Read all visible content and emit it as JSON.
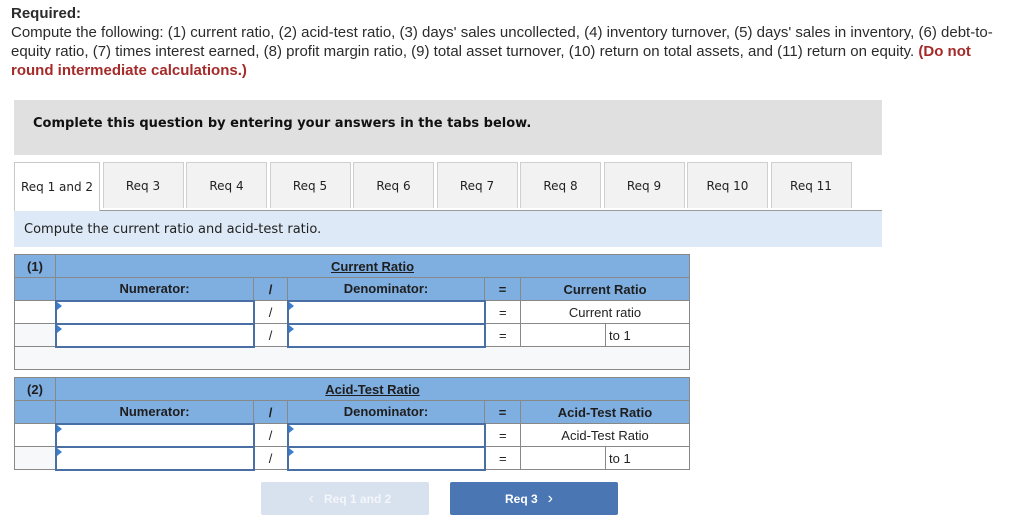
{
  "required": {
    "heading": "Required:",
    "text": "Compute the following: (1) current ratio, (2) acid-test ratio, (3) days' sales uncollected, (4) inventory turnover, (5) days' sales in inventory, (6) debt-to-equity ratio, (7) times interest earned, (8) profit margin ratio, (9) total asset turnover, (10) return on total assets, and (11) return on equity.",
    "warning": "(Do not round intermediate calculations.)"
  },
  "banner": "Complete this question by entering your answers in the tabs below.",
  "tabs": [
    {
      "label": "Req 1 and 2",
      "active": true
    },
    {
      "label": "Req 3"
    },
    {
      "label": "Req 4"
    },
    {
      "label": "Req 5"
    },
    {
      "label": "Req 6"
    },
    {
      "label": "Req 7"
    },
    {
      "label": "Req 8"
    },
    {
      "label": "Req 9"
    },
    {
      "label": "Req 10"
    },
    {
      "label": "Req 11"
    }
  ],
  "instruction": "Compute the current ratio and acid-test ratio.",
  "section1": {
    "number": "(1)",
    "title": "Current Ratio",
    "numerator_header": "Numerator:",
    "div_symbol": "/",
    "denominator_header": "Denominator:",
    "eq_symbol": "=",
    "result_header": "Current Ratio",
    "row1_result_label": "Current ratio",
    "row2_suffix": "to 1",
    "numerator_values": [
      "",
      ""
    ],
    "denominator_values": [
      "",
      ""
    ],
    "ratio_value": ""
  },
  "section2": {
    "number": "(2)",
    "title": "Acid-Test Ratio",
    "numerator_header": "Numerator:",
    "div_symbol": "/",
    "denominator_header": "Denominator:",
    "eq_symbol": "=",
    "result_header": "Acid-Test Ratio",
    "row1_result_label": "Acid-Test Ratio",
    "row2_suffix": "to 1",
    "numerator_values": [
      "",
      ""
    ],
    "denominator_values": [
      "",
      ""
    ],
    "ratio_value": ""
  },
  "nav": {
    "prev_label": "Req 1 and 2",
    "next_label": "Req 3",
    "prev_icon": "chevron-left-icon",
    "next_icon": "chevron-right-icon"
  }
}
